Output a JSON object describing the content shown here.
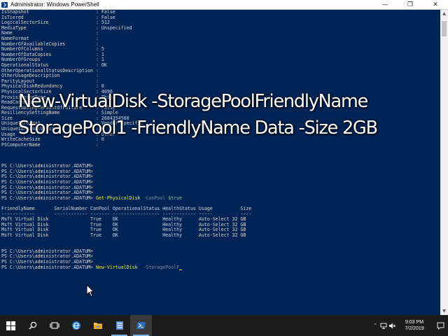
{
  "window": {
    "title": "Administrator: Windows PowerShell",
    "minimize_glyph": "—",
    "maximize_glyph": "❐",
    "close_glyph": "✕"
  },
  "console": {
    "lines": [
      "IsSnapshot                        : False",
      "IsTiered                          : False",
      "LogicalSectorSize                 : 512",
      "MediaType                         : Unspecified",
      "Name                              :",
      "NameFormat                        :",
      "NumberOfAvailableCopies           :",
      "NumberOfColumns                   : 5",
      "NumberOfDataCopies                : 1",
      "NumberOfGroups                    : 1",
      "OperationalStatus                 : OK",
      "OtherOperationalStatusDescription :",
      "OtherUsageDescription             :",
      "ParityLayout                      :",
      "PhysicalDiskRedundancy            : 0",
      "PhysicalSectorSize                : 4096",
      "ProvisioningType                  : Thin",
      "ReadCacheSize                     : 0",
      "RequestNoSinglePointOfFailure     : False",
      "ResiliencySettingName             : Simple",
      "Size                              : 2684354560",
      "UniqueIdFormat                    : Vendor Specific",
      "UniqueIdFormatVersion             :",
      "Usage                             : Other",
      "WriteCacheSize                    : 0",
      "PSComputerName                    :",
      "",
      "",
      "",
      "PS C:\\Users\\administrator.ADATUM>",
      "PS C:\\Users\\administrator.ADATUM>",
      "PS C:\\Users\\administrator.ADATUM>",
      "PS C:\\Users\\administrator.ADATUM>",
      "PS C:\\Users\\administrator.ADATUM>",
      "PS C:\\Users\\administrator.ADATUM>"
    ],
    "prompt": "PS C:\\Users\\administrator.ADATUM>",
    "cmd1": {
      "name": "Get-PhysicalDisk",
      "param": "-CanPool",
      "value": "$true"
    },
    "table_header": "FriendlyName       SerialNumber CanPool OperationalStatus HealthStatus Usage          Size",
    "table_rule": "------------       ------------ ------- ----------------- ------------ -----          ----",
    "table_rows": [
      "Msft Virtual Disk               True    OK                Healthy      Auto-Select 32 GB",
      "Msft Virtual Disk               True    OK                Healthy      Auto-Select 32 GB",
      "Msft Virtual Disk               True    OK                Healthy      Auto-Select 32 GB",
      "Msft Virtual Disk               True    OK                Healthy      Auto-Select 32 GB"
    ],
    "cmd2": {
      "name": "New-VirtualDisk",
      "param": "-StoragePoolF"
    }
  },
  "overlay": {
    "line1": "New-VirtualDisk -StoragePoolFriendlyName",
    "line2": "StoragePool1 -FriendlyName Data -Size 2GB"
  },
  "taskbar": {
    "time": "9:03 PM",
    "date": "7/2/2019",
    "icons": [
      "start-icon",
      "search-icon",
      "task-view-icon",
      "edge-icon",
      "file-explorer-icon",
      "server-manager-icon",
      "powershell-icon"
    ]
  },
  "colors": {
    "console_bg": "#012456",
    "command_yellow": "#f0f020",
    "param_gray": "#8a8a8a",
    "taskbar_bg": "#1c1c1c"
  }
}
